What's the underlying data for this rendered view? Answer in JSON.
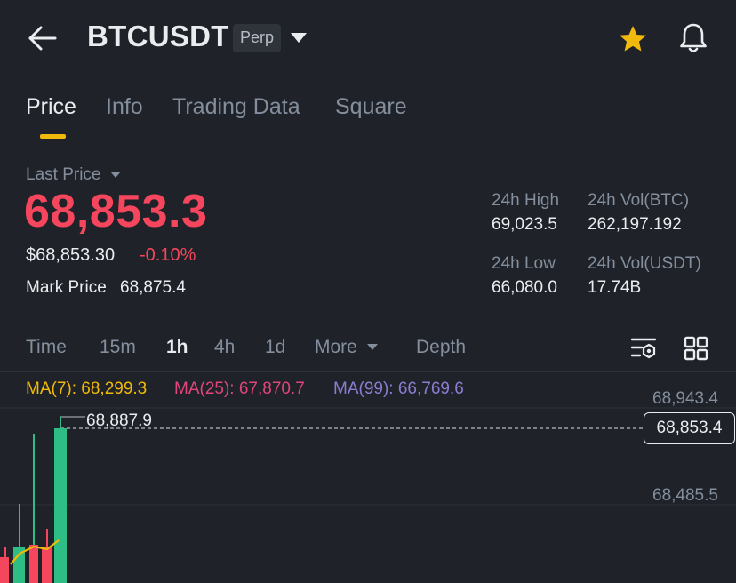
{
  "header": {
    "symbol": "BTCUSDT",
    "contract_badge": "Perp"
  },
  "tabs": [
    {
      "label": "Price",
      "active": true
    },
    {
      "label": "Info",
      "active": false
    },
    {
      "label": "Trading Data",
      "active": false
    },
    {
      "label": "Square",
      "active": false
    }
  ],
  "price": {
    "last_price_label": "Last Price",
    "last_price": "68,853.3",
    "usd_price": "$68,853.30",
    "change_pct": "-0.10%",
    "mark_price_label": "Mark Price",
    "mark_price": "68,875.4"
  },
  "stats": {
    "high_label": "24h High",
    "high_value": "69,023.5",
    "vol_btc_label": "24h Vol(BTC)",
    "vol_btc_value": "262,197.192",
    "low_label": "24h Low",
    "low_value": "66,080.0",
    "vol_usdt_label": "24h Vol(USDT)",
    "vol_usdt_value": "17.74B"
  },
  "intervals": {
    "time": "Time",
    "m15": "15m",
    "h1": "1h",
    "h4": "4h",
    "d1": "1d",
    "more": "More",
    "depth": "Depth",
    "selected": "1h"
  },
  "moving_averages": [
    {
      "label": "MA(7): 68,299.3",
      "color": "#f0b90b"
    },
    {
      "label": "MA(25): 67,870.7",
      "color": "#e0457b"
    },
    {
      "label": "MA(99): 66,769.6",
      "color": "#8c7cd1"
    }
  ],
  "chart": {
    "axis_top": "68,943.4",
    "axis_mid": "68,485.5",
    "current_price": "68,853.4",
    "high_marker": "68,887.9"
  },
  "icons": {
    "back": "arrow-left-icon",
    "dropdown": "caret-down-icon",
    "favorite": "star-icon",
    "alert": "bell-icon",
    "indicator_settings": "chart-settings-icon",
    "layout": "grid-icon"
  },
  "colors": {
    "background": "#1f2329",
    "up": "#2ebd85",
    "down": "#f6465d",
    "accent": "#f0b90b",
    "muted": "#848e9c",
    "favorite_active": "#f0b90b"
  }
}
